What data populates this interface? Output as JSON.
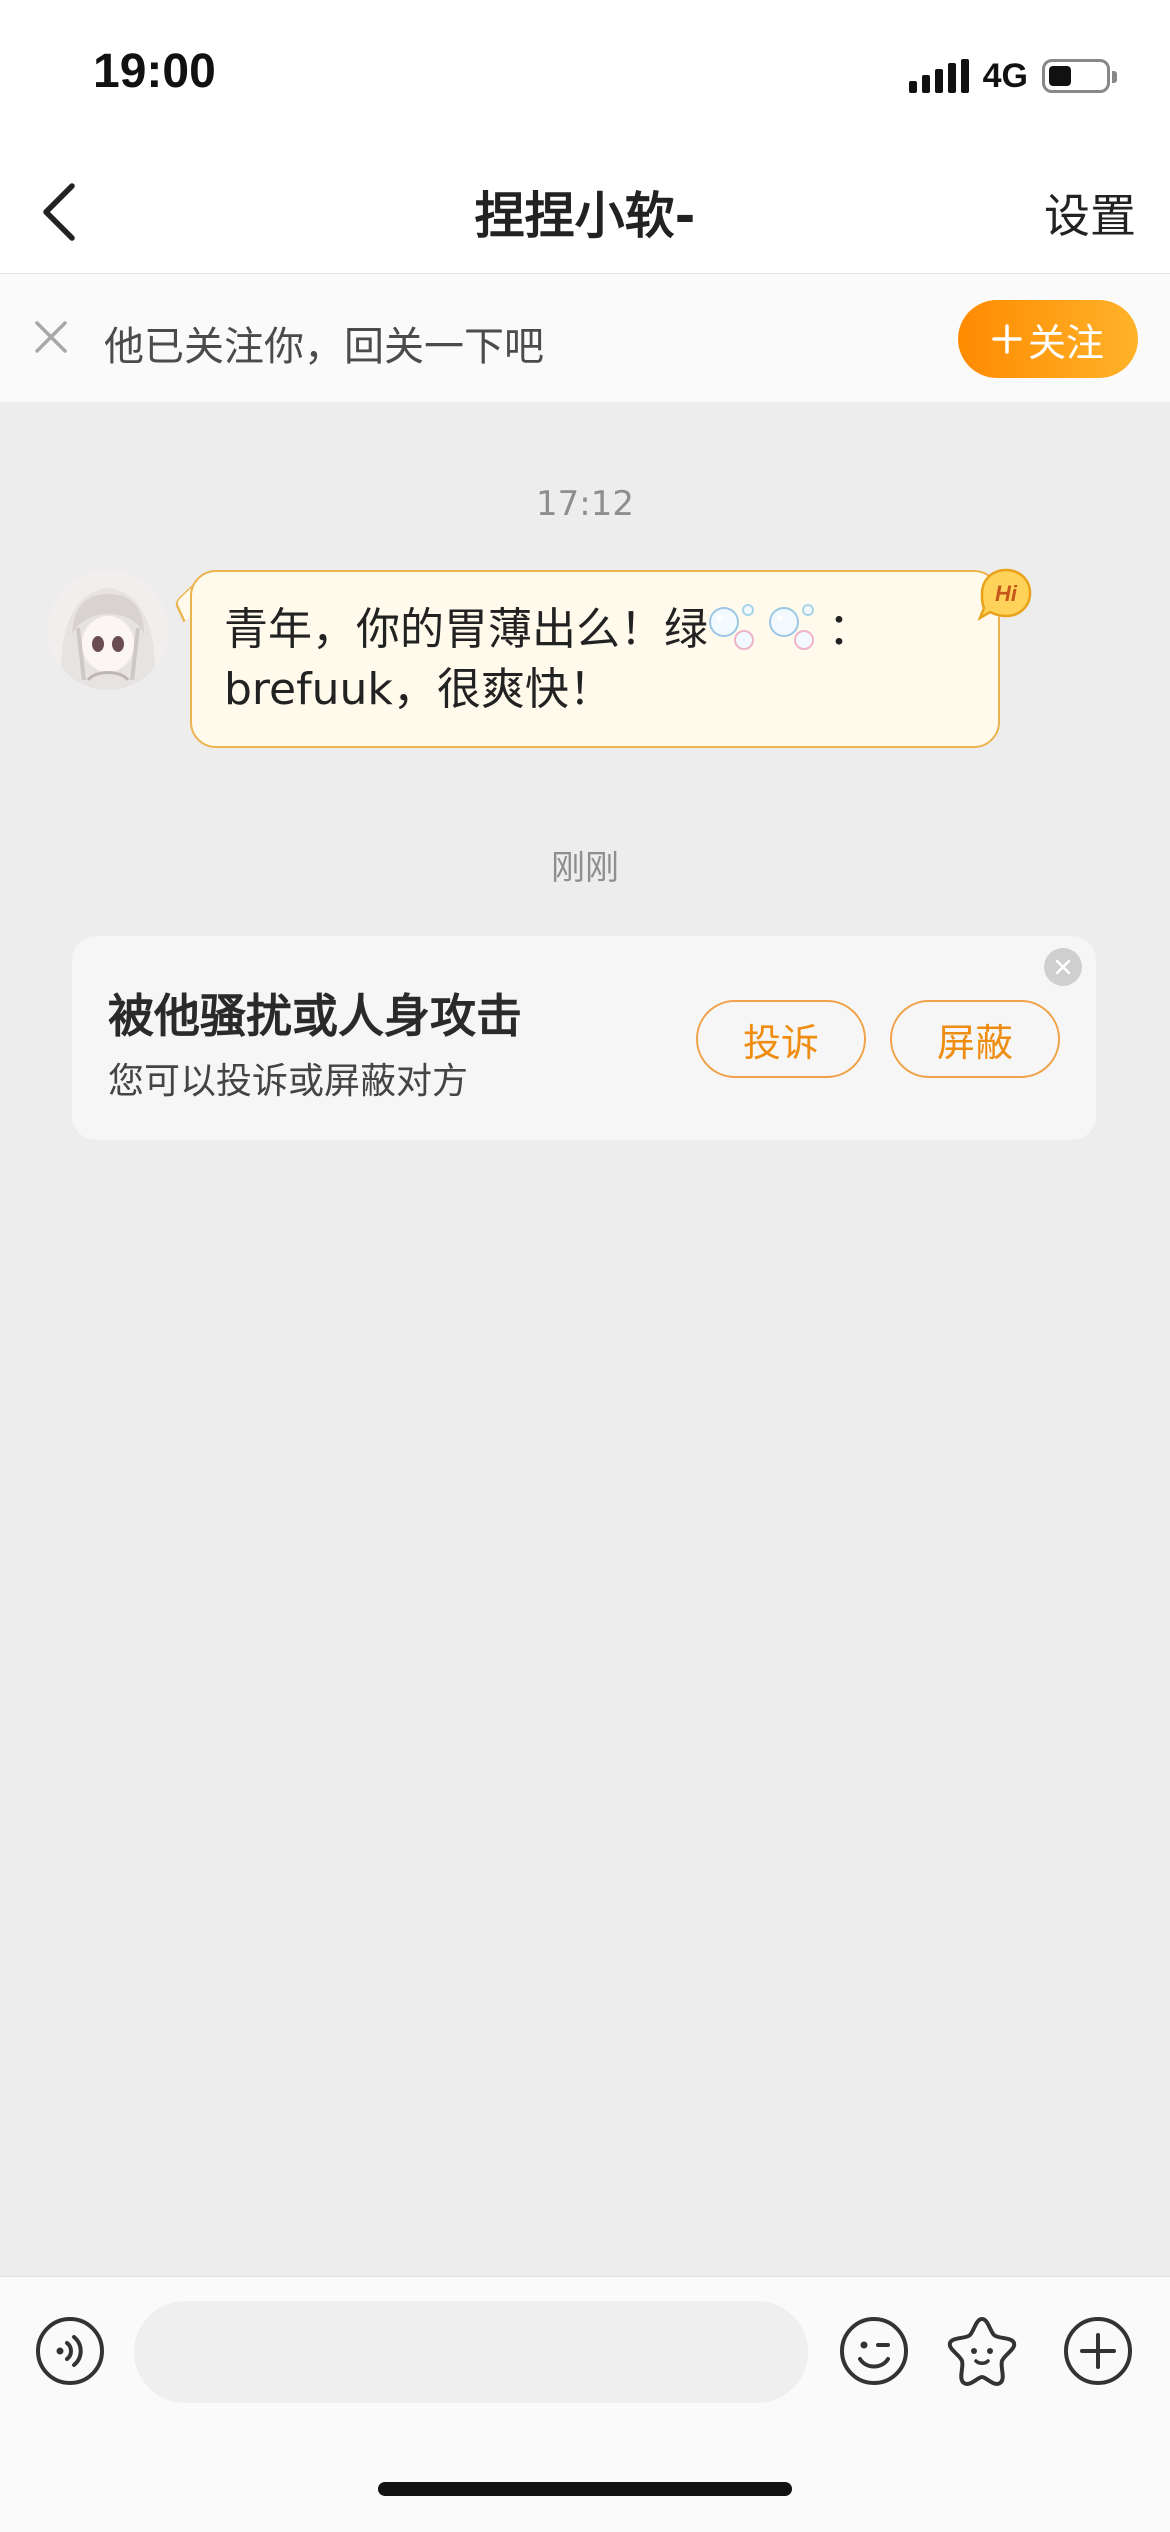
{
  "status_bar": {
    "time": "19:00",
    "network": "4G",
    "icons": [
      "signal-icon",
      "battery-icon"
    ]
  },
  "nav": {
    "title": "捏捏小软-",
    "settings_label": "设置",
    "back_icon": "chevron-left-icon"
  },
  "follow_banner": {
    "text": "他已关注你，回关一下吧",
    "button_label": "关注",
    "button_icon": "plus-icon",
    "close_icon": "close-icon",
    "accent": "#ff8a00"
  },
  "messages": [
    {
      "timestamp": "17:12",
      "sender": "other",
      "text_part1": "青年，你的胃薄出么！绿",
      "emoji": "bubbles-emoji",
      "text_part2": "：",
      "text_line2": "brefuuk，很爽快！",
      "badge": "Hi"
    }
  ],
  "system": {
    "timestamp": "刚刚",
    "card_title": "被他骚扰或人身攻击",
    "card_subtitle": "您可以投诉或屏蔽对方",
    "report_label": "投诉",
    "block_label": "屏蔽"
  },
  "input_bar": {
    "placeholder": "",
    "icons": [
      "voice-icon",
      "emoji-icon",
      "sticker-icon",
      "plus-icon"
    ]
  },
  "colors": {
    "bubble_bg": "#fffaec",
    "bubble_border": "#ecb44e",
    "chat_bg": "#ededed",
    "action_orange": "#ef8d12"
  }
}
